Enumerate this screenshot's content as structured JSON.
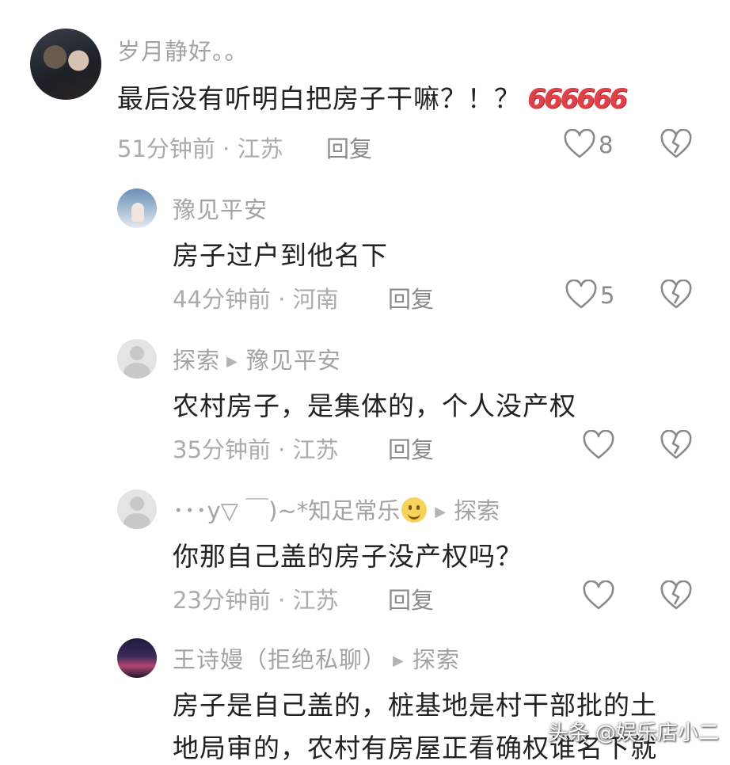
{
  "comments": [
    {
      "username": "岁月静好。。",
      "content": "最后没有听明白把房子干嘛？！？",
      "emote": "666666",
      "time": "51分钟前",
      "location": "江苏",
      "reply_label": "回复",
      "likes": "8"
    },
    {
      "username": "豫见平安",
      "content": "房子过户到他名下",
      "time": "44分钟前",
      "location": "河南",
      "reply_label": "回复",
      "likes": "5"
    },
    {
      "username": "探索",
      "reply_to": "豫见平安",
      "content": "农村房子，是集体的，个人没产权",
      "time": "35分钟前",
      "location": "江苏",
      "reply_label": "回复",
      "likes": ""
    },
    {
      "username_prefix": "･･･y▽ ￣)~*知足常乐",
      "reply_to": "探索",
      "content": "你那自己盖的房子没产权吗？",
      "time": "23分钟前",
      "location": "江苏",
      "reply_label": "回复",
      "likes": ""
    },
    {
      "username": "王诗嫚（拒绝私聊）",
      "reply_to": "探索",
      "content_line1": "房子是自己盖的，桩基地是村干部批的土",
      "content_line2": "地局审的，农村有房屋正看确权谁名下就"
    }
  ],
  "meta_separator": " · ",
  "watermark": "头条 @娱乐店小二",
  "colors": {
    "username": "#a3a3a3",
    "content": "#222222",
    "meta": "#ababab",
    "icon": "#8a8a8a"
  }
}
